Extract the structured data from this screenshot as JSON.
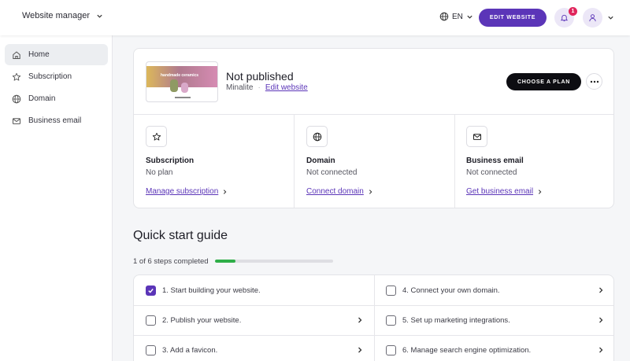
{
  "topbar": {
    "site_manager_label": "Website manager",
    "language": "EN",
    "edit_button_label": "EDIT WEBSITE",
    "notification_count": "1"
  },
  "sidebar": {
    "items": [
      {
        "label": "Home",
        "icon": "home-icon",
        "active": true
      },
      {
        "label": "Subscription",
        "icon": "star-icon"
      },
      {
        "label": "Domain",
        "icon": "globe-icon"
      },
      {
        "label": "Business email",
        "icon": "mail-icon"
      }
    ]
  },
  "site": {
    "thumbnail_text": "handmade ceramics",
    "status_title": "Not published",
    "template_name": "Minalite",
    "separator": "·",
    "edit_link": "Edit website",
    "plan_button_label": "CHOOSE A PLAN"
  },
  "features": [
    {
      "icon": "star-icon",
      "title": "Subscription",
      "status": "No plan",
      "link": "Manage subscription"
    },
    {
      "icon": "globe-icon",
      "title": "Domain",
      "status": "Not connected",
      "link": "Connect domain"
    },
    {
      "icon": "mail-icon",
      "title": "Business email",
      "status": "Not connected",
      "link": "Get business email"
    }
  ],
  "quick_start": {
    "title": "Quick start guide",
    "progress_text": "1 of 6 steps completed",
    "progress_fraction": 0.17,
    "steps": [
      {
        "label": "1. Start building your website.",
        "checked": true
      },
      {
        "label": "2. Publish your website.",
        "checked": false
      },
      {
        "label": "3. Add a favicon.",
        "checked": false
      },
      {
        "label": "4. Connect your own domain.",
        "checked": false
      },
      {
        "label": "5. Set up marketing integrations.",
        "checked": false
      },
      {
        "label": "6. Manage search engine optimization.",
        "checked": false
      }
    ]
  },
  "colors": {
    "accent": "#5b35b8",
    "progress": "#2fae48",
    "badge": "#e0255c"
  }
}
